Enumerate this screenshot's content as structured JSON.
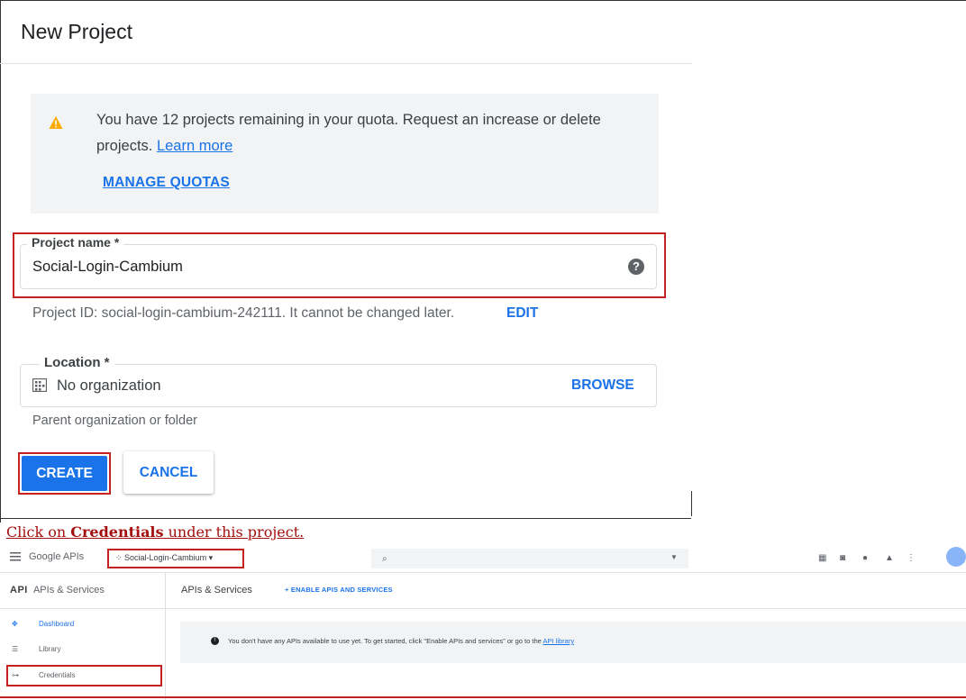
{
  "dialog": {
    "title": "New Project",
    "quota": {
      "message": "You have 12 projects remaining in your quota. Request an increase or delete projects.",
      "learn_more": "Learn more",
      "manage_quotas": "MANAGE QUOTAS"
    },
    "project_name": {
      "label": "Project name *",
      "value": "Social-Login-Cambium"
    },
    "project_id": {
      "text": "Project ID: social-login-cambium-242111. It cannot be changed later.",
      "edit": "EDIT"
    },
    "location": {
      "label": "Location *",
      "value": "No organization",
      "browse": "BROWSE",
      "hint": "Parent organization or folder"
    },
    "buttons": {
      "create": "CREATE",
      "cancel": "CANCEL"
    }
  },
  "instruction": {
    "prefix": "Click on ",
    "bold": "Credentials",
    "suffix": " under this project."
  },
  "console": {
    "brand": "Google APIs",
    "project_selector": "Social-Login-Cambium",
    "sidebar": {
      "api_badge": "API",
      "title": "APIs & Services",
      "items": [
        {
          "label": "Dashboard",
          "icon": "dashboard-icon"
        },
        {
          "label": "Library",
          "icon": "library-icon"
        },
        {
          "label": "Credentials",
          "icon": "key-icon"
        }
      ]
    },
    "main": {
      "title": "APIs & Services",
      "enable_button": "+ ENABLE APIS AND SERVICES",
      "notice": "You don't have any APIs available to use yet. To get started, click \"Enable APIs and services\" or go to the ",
      "notice_link": "API library"
    }
  }
}
